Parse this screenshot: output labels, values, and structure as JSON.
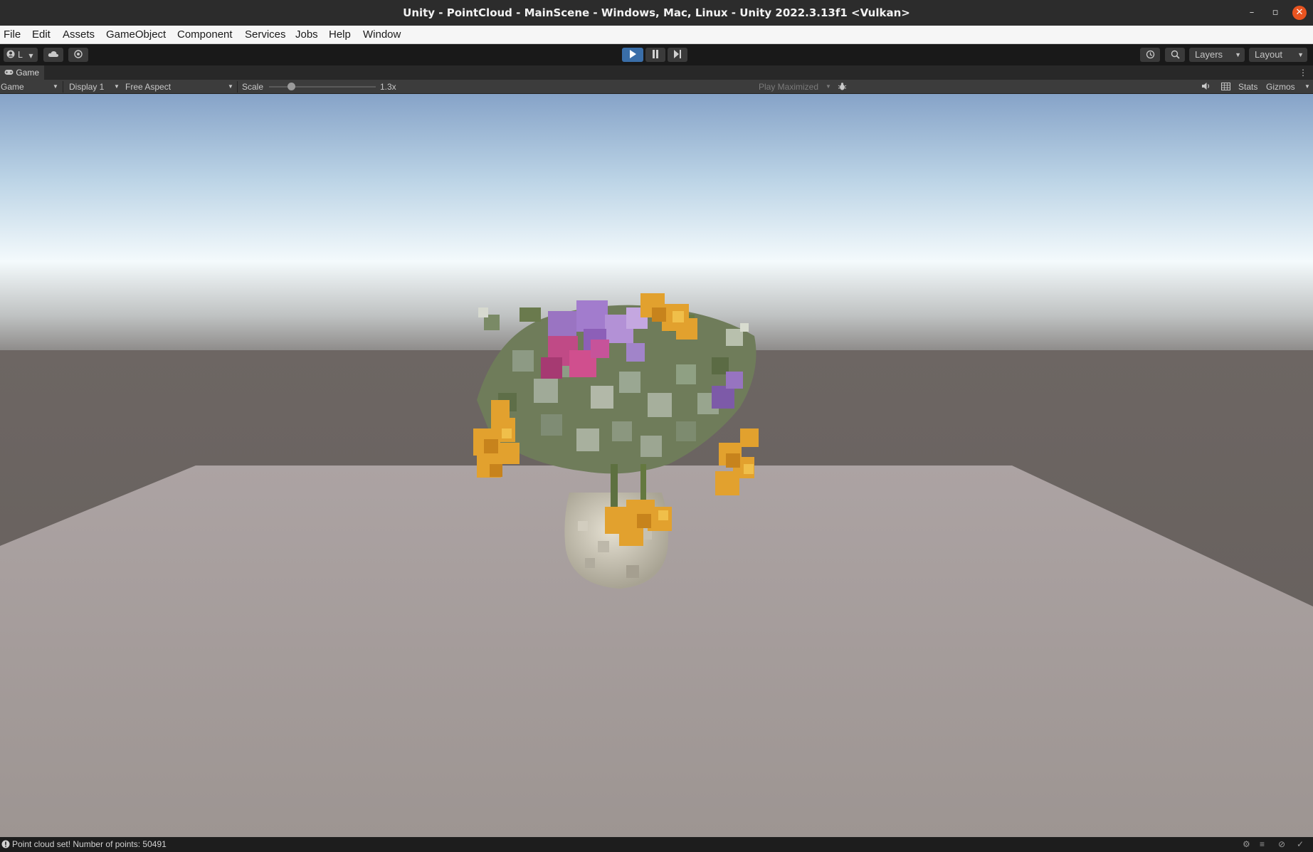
{
  "window": {
    "title": "Unity - PointCloud - MainScene - Windows, Mac, Linux - Unity 2022.3.13f1 <Vulkan>"
  },
  "menu": {
    "items": [
      "File",
      "Edit",
      "Assets",
      "GameObject",
      "Component",
      "Services",
      "Jobs",
      "Help",
      "Window"
    ]
  },
  "toolbar": {
    "account_label": "L",
    "layers_label": "Layers",
    "layout_label": "Layout"
  },
  "tab": {
    "label": "Game"
  },
  "gameview": {
    "mode": "Game",
    "display": "Display 1",
    "aspect": "Free Aspect",
    "scale_label": "Scale",
    "scale_value": "1.3x",
    "scale_fraction": 0.17,
    "play_maximized": "Play Maximized",
    "stats_label": "Stats",
    "gizmos_label": "Gizmos"
  },
  "status": {
    "message": "Point cloud set! Number of points: 50491"
  },
  "colors": {
    "accent_play": "#3a6ea8",
    "close": "#e95420"
  },
  "icons": [
    "unity-account-icon",
    "cloud-icon",
    "collab-icon",
    "play-icon",
    "pause-icon",
    "step-icon",
    "history-icon",
    "search-icon",
    "gamepad-icon",
    "bug-icon",
    "audio-icon",
    "grid-icon",
    "info-icon"
  ]
}
